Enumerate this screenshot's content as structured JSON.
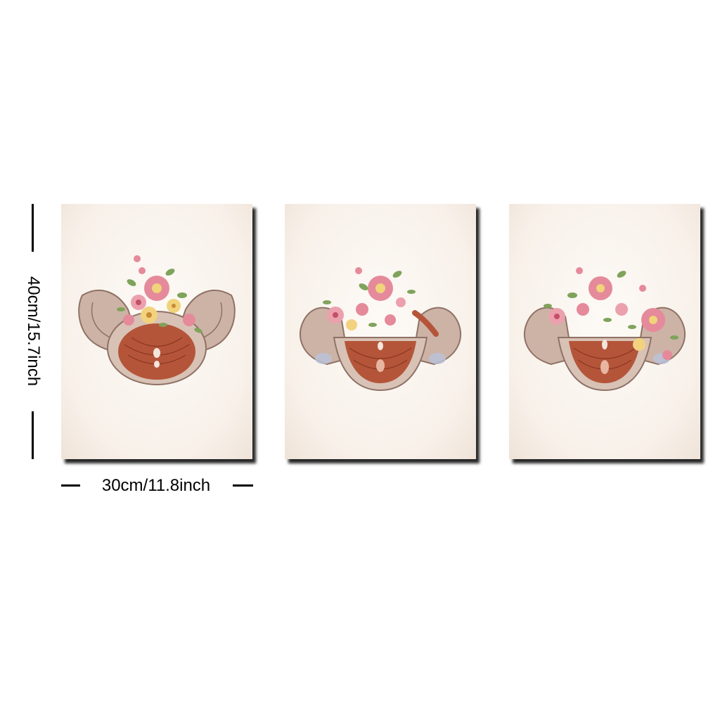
{
  "dimensions": {
    "height_label": "40cm/15.7inch",
    "width_label": "30cm/11.8inch"
  },
  "panels": [
    {
      "subject": "pelvis-anatomy-with-flowers",
      "variant": "top-view"
    },
    {
      "subject": "pelvis-anatomy-with-flowers",
      "variant": "frontal-view"
    },
    {
      "subject": "pelvis-anatomy-with-flowers",
      "variant": "frontal-view-dense-flowers"
    }
  ],
  "colors": {
    "bone": "#c9b0a2",
    "muscle": "#b4553a",
    "flower_pink": "#e58a9b",
    "flower_yellow": "#f0d37a",
    "leaf": "#7fa35b",
    "paper": "#f8f1ea"
  }
}
